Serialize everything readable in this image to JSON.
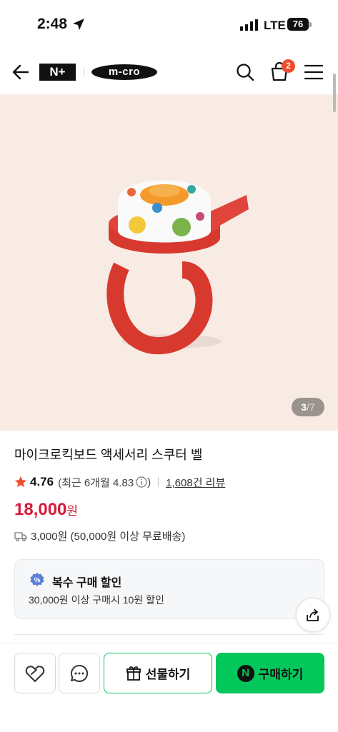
{
  "status_bar": {
    "time": "2:48",
    "network": "LTE",
    "battery": "76"
  },
  "header": {
    "logo_nplus": "N+",
    "logo_brand": "m-cro",
    "cart_count": "2"
  },
  "gallery": {
    "current": "3",
    "total": "7",
    "slash": "/"
  },
  "product": {
    "title": "마이크로킥보드 액세서리 스쿠터 벨",
    "rating": "4.76",
    "recent_rating": "(최근 6개월 4.83",
    "recent_close": ")",
    "review_count": "1,608건 리뷰",
    "price": "18,000",
    "price_unit": "원",
    "shipping": "3,000원 (50,000원 이상 무료배송)"
  },
  "discount": {
    "title": "복수 구매 할인",
    "description": "30,000원 이상 구매시 10원 할인"
  },
  "bottom_bar": {
    "gift_label": "선물하기",
    "buy_label": "구매하기",
    "npay_mark": "N"
  },
  "colors": {
    "price": "#d81a3a",
    "naver_green": "#03c75a",
    "hero_bg": "#f8ebe3",
    "badge": "#f04b2b"
  }
}
